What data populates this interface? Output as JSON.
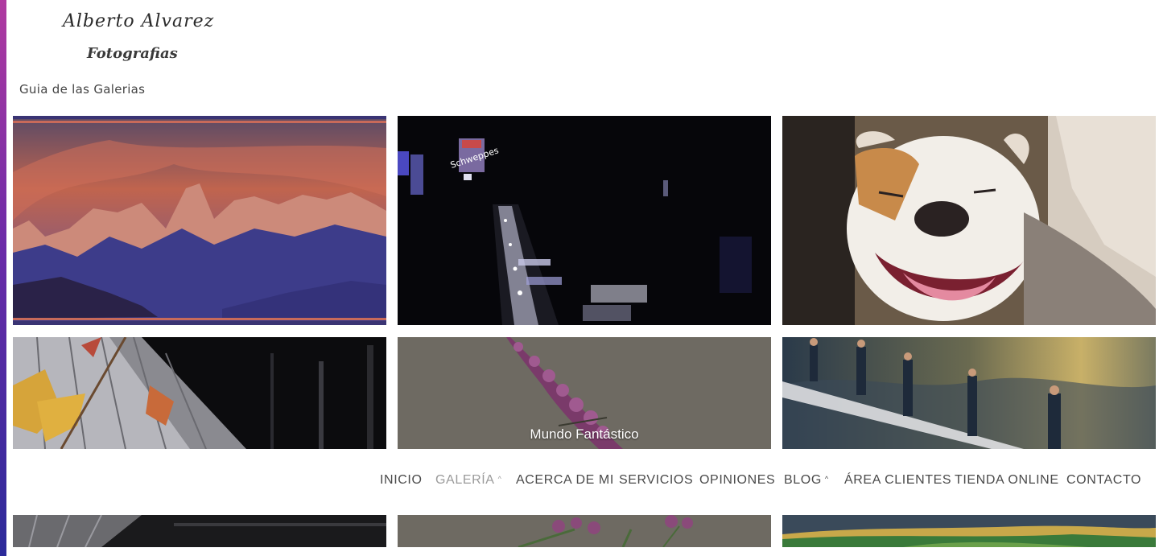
{
  "brand": {
    "script_name": "Alberto Alvarez",
    "subtitle": "Fotografias"
  },
  "guide_title": "Guia de las Galerias",
  "gallery": {
    "tiles": [
      {
        "scene": "mountains-sunset"
      },
      {
        "scene": "city-night-street",
        "sign_text": "Schweppes"
      },
      {
        "scene": "bulldog"
      },
      {
        "scene": "window-leaves"
      },
      {
        "scene": "purple-flower",
        "caption": "Mundo Fantástico"
      },
      {
        "scene": "surfers-storm"
      },
      {
        "scene": "reflection-dark"
      },
      {
        "scene": "flower-second"
      },
      {
        "scene": "green-fields"
      }
    ]
  },
  "nav": {
    "items": [
      {
        "label": "INICIO",
        "active": false,
        "dropdown": false
      },
      {
        "label": "GALERÍA",
        "active": true,
        "dropdown": true
      },
      {
        "label": "ACERCA DE MI",
        "active": false,
        "dropdown": false
      },
      {
        "label": "SERVICIOS",
        "active": false,
        "dropdown": false
      },
      {
        "label": "OPINIONES",
        "active": false,
        "dropdown": false
      },
      {
        "label": "BLOG",
        "active": false,
        "dropdown": true
      },
      {
        "label": "ÁREA CLIENTES",
        "active": false,
        "dropdown": false
      },
      {
        "label": "TIENDA ONLINE",
        "active": false,
        "dropdown": false
      },
      {
        "label": "CONTACTO",
        "active": false,
        "dropdown": false
      }
    ],
    "caret_icon": "chevron-up-icon"
  },
  "colors": {
    "edge_gradient": [
      "#b03aa0",
      "#6a2aa8",
      "#2b2a9a"
    ],
    "nav_text": "#4a4a4a",
    "nav_active": "#9a9a9a"
  }
}
